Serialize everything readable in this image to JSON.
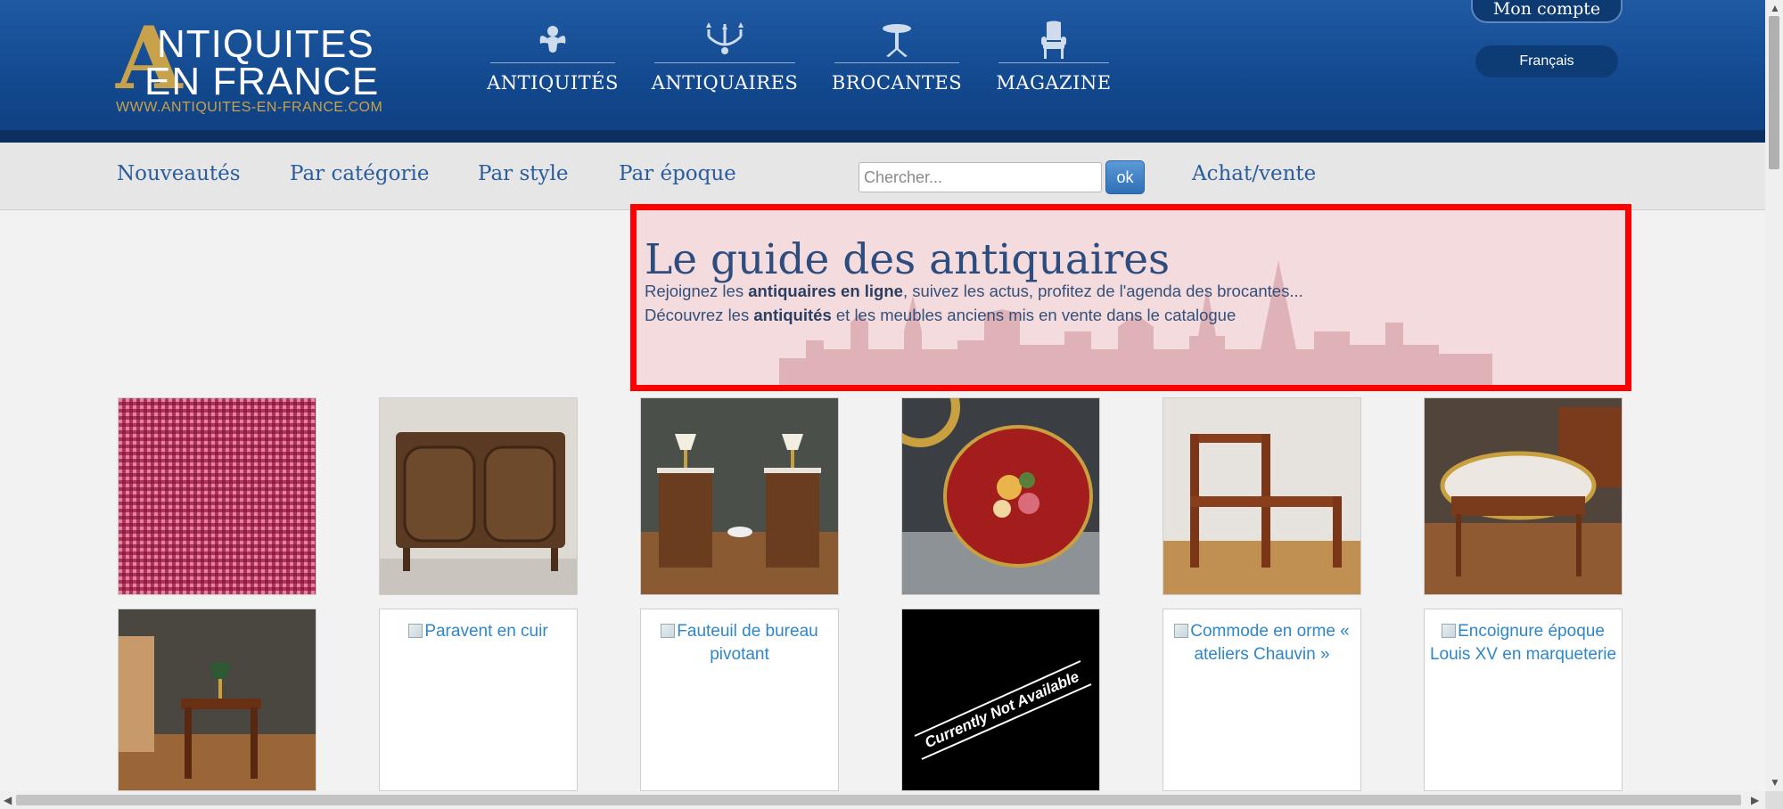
{
  "logo": {
    "big_letter": "A",
    "line1": "NTIQUITES",
    "line2": "EN FRANCE",
    "url": "WWW.ANTIQUITES-EN-FRANCE.COM"
  },
  "main_nav": [
    {
      "label": "ANTIQUITÉS",
      "icon": "cherub-icon"
    },
    {
      "label": "ANTIQUAIRES",
      "icon": "chandelier-icon"
    },
    {
      "label": "BROCANTES",
      "icon": "pedestal-table-icon"
    },
    {
      "label": "MAGAZINE",
      "icon": "armchair-icon"
    }
  ],
  "account": {
    "label": "Mon compte"
  },
  "language": {
    "selected": "Français"
  },
  "subnav": {
    "links": [
      "Nouveautés",
      "Par catégorie",
      "Par style",
      "Par époque"
    ],
    "search_placeholder": "Chercher...",
    "search_button": "ok",
    "achat_vente": "Achat/vente"
  },
  "hero": {
    "title": "Le guide des antiquaires",
    "line1_pre": "Rejoignez les ",
    "line1_bold": "antiquaires en ligne",
    "line1_post": ", suivez les actus, profitez de l'agenda des brocantes...",
    "line2_pre": "Découvrez les ",
    "line2_bold": "antiquités",
    "line2_post": " et les meubles anciens mis en vente dans le catalogue"
  },
  "grid": {
    "row2_alt_texts": {
      "paravent": "Paravent en cuir",
      "fauteuil": "Fauteuil de bureau pivotant",
      "commode": "Commode en orme « ateliers Chauvin »",
      "encoignure": "Encoignure époque Louis XV en marqueterie"
    },
    "not_available": "Currently Not Available"
  },
  "colors": {
    "header_blue": "#13498f",
    "gold": "#c8a24b",
    "link_blue": "#2a5d9d",
    "highlight_red": "#ff0000"
  }
}
